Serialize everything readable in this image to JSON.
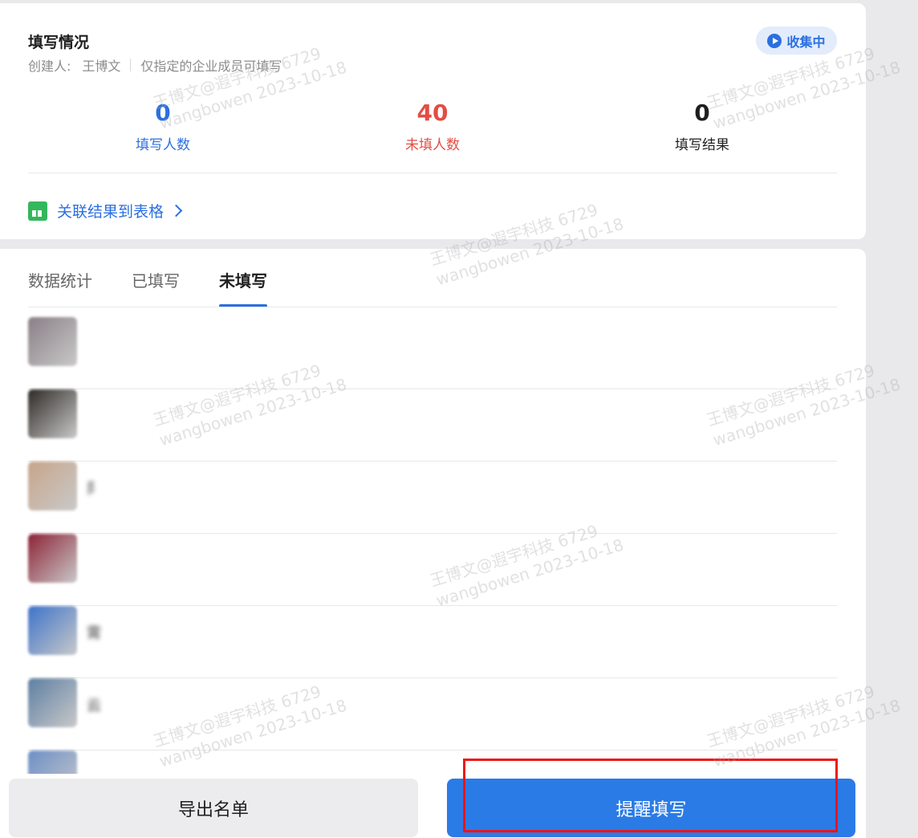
{
  "header": {
    "title": "填写情况",
    "creator_label": "创建人:",
    "creator_name": "王博文",
    "permission": "仅指定的企业成员可填写",
    "status_badge": "收集中"
  },
  "stats": [
    {
      "value": "0",
      "label": "填写人数",
      "color": "#2b6fe0"
    },
    {
      "value": "40",
      "label": "未填人数",
      "color": "#e34d43"
    },
    {
      "value": "0",
      "label": "填写结果",
      "color": "#1f1f1f"
    }
  ],
  "link_label": "关联结果到表格",
  "tabs": [
    {
      "label": "数据统计",
      "active": false
    },
    {
      "label": "已填写",
      "active": false
    },
    {
      "label": "未填写",
      "active": true
    }
  ],
  "members": [
    {
      "name": "",
      "avatar_color": "#8a7f86"
    },
    {
      "name": "",
      "avatar_color": "#2e2a26"
    },
    {
      "name": "阝",
      "avatar_color": "#c7a58a"
    },
    {
      "name": "",
      "avatar_color": "#8d2236"
    },
    {
      "name": "霄",
      "avatar_color": "#3d73c9"
    },
    {
      "name": "云",
      "avatar_color": "#5d7fa3"
    },
    {
      "name": "",
      "avatar_color": "#6c8fc7"
    }
  ],
  "buttons": {
    "export": "导出名单",
    "remind": "提醒填写"
  },
  "watermark": {
    "line1": "王博文@遐宇科技 6729",
    "line2": "wangbowen 2023-10-18"
  }
}
